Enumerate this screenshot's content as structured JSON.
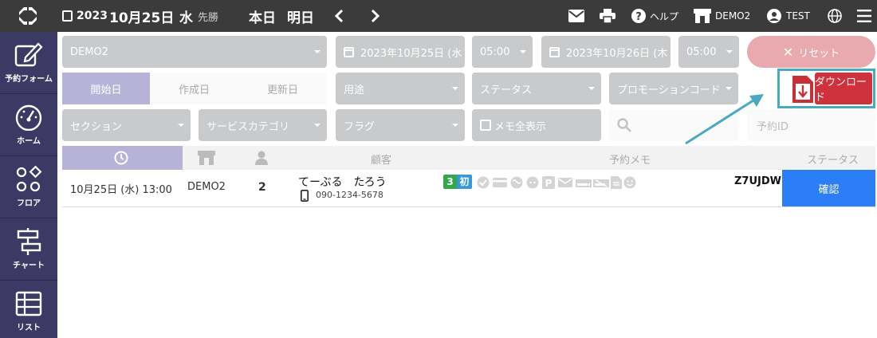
{
  "topbar": {
    "date_year": "2023",
    "date_main": "10月25日",
    "weekday": "水",
    "rokuyo": "先勝",
    "today_label": "本日",
    "tomorrow_label": "明日",
    "help_label": "ヘルプ",
    "store_label": "DEMO2",
    "user_label": "TEST"
  },
  "sidebar": {
    "items": [
      {
        "label": "予約フォーム",
        "icon": "edit-icon"
      },
      {
        "label": "ホーム",
        "icon": "dashboard-icon"
      },
      {
        "label": "フロア",
        "icon": "floor-icon"
      },
      {
        "label": "チャート",
        "icon": "chart-icon"
      },
      {
        "label": "リスト",
        "icon": "list-icon"
      }
    ]
  },
  "filters": {
    "store": "DEMO2",
    "start_date": "2023年10月25日 (水",
    "start_time": "05:00",
    "end_date": "2023年10月26日 (木",
    "end_time": "05:00",
    "reset_label": "リセット",
    "segments": [
      "開始日",
      "作成日",
      "更新日"
    ],
    "purpose": "用途",
    "status": "ステータス",
    "promotion": "プロモーションコード",
    "download_label": "ダウンロード",
    "section": "セクション",
    "service_category": "サービスカテゴリ",
    "flag": "フラグ",
    "memo_all": "メモ全表示",
    "search_placeholder": "",
    "reservation_id_placeholder": "予約ID"
  },
  "table": {
    "headers": {
      "customer": "顧客",
      "memo": "予約メモ",
      "status": "ステータス"
    },
    "rows": [
      {
        "datetime": "10月25日 (水) 13:00",
        "store": "DEMO2",
        "people": "2",
        "name": "てーぶる　たろう",
        "phone": "090-1234-5678",
        "visits_badge": "3",
        "first_badge": "初",
        "reservation_code": "Z7UJDW",
        "status": "確認"
      }
    ]
  },
  "colors": {
    "topbar": "#3b3b3b",
    "sidebar": "#3c3a64",
    "status_blue": "#2b7ef5",
    "download_red": "#d0323d",
    "highlight": "#4aa9c2"
  }
}
